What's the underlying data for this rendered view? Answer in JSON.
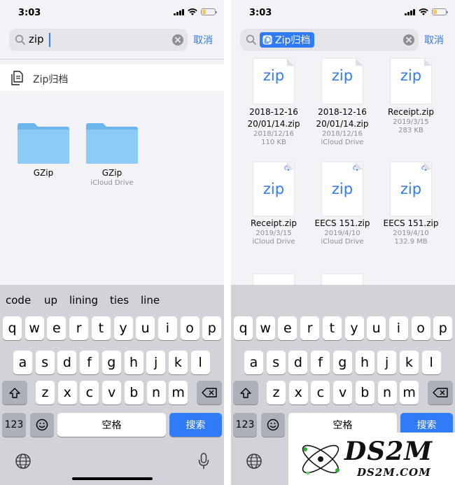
{
  "status_bar": {
    "time": "3:03"
  },
  "left_screen": {
    "search": {
      "query": "zip",
      "cancel_label": "取消"
    },
    "suggestion": {
      "label": "Zip归档"
    },
    "folders": [
      {
        "name": "GZip",
        "location": ""
      },
      {
        "name": "GZip",
        "location": "iCloud Drive"
      }
    ],
    "predictive_words": [
      "code",
      "up",
      "lining",
      "ties",
      "line"
    ]
  },
  "right_screen": {
    "search": {
      "token_label": "Zip归档",
      "cancel_label": "取消"
    },
    "files": [
      {
        "icon_text": "zip",
        "name_line1": "2018-12-16",
        "name_line2": "20/01/14.zip",
        "date": "2018/12/16",
        "detail": "110 KB",
        "cloud": false
      },
      {
        "icon_text": "zip",
        "name_line1": "2018-12-16",
        "name_line2": "20/01/14.zip",
        "date": "2018/12/16",
        "detail": "iCloud Drive",
        "cloud": false
      },
      {
        "icon_text": "zip",
        "name_line1": "Receipt.zip",
        "name_line2": "",
        "date": "2019/3/15",
        "detail": "283 KB",
        "cloud": false
      },
      {
        "icon_text": "zip",
        "name_line1": "Receipt.zip",
        "name_line2": "",
        "date": "2019/3/15",
        "detail": "iCloud Drive",
        "cloud": true
      },
      {
        "icon_text": "zip",
        "name_line1": "EECS 151.zip",
        "name_line2": "",
        "date": "2019/4/10",
        "detail": "iCloud Drive",
        "cloud": true
      },
      {
        "icon_text": "zip",
        "name_line1": "EECS 151.zip",
        "name_line2": "",
        "date": "2019/4/10",
        "detail": "132.9 MB",
        "cloud": true
      }
    ]
  },
  "keyboard": {
    "row1": [
      "q",
      "w",
      "e",
      "r",
      "t",
      "y",
      "u",
      "i",
      "o",
      "p"
    ],
    "row2": [
      "a",
      "s",
      "d",
      "f",
      "g",
      "h",
      "j",
      "k",
      "l"
    ],
    "row3": [
      "z",
      "x",
      "c",
      "v",
      "b",
      "n",
      "m"
    ],
    "numbers_label": "123",
    "space_label": "空格",
    "search_label": "搜索",
    "icons": {
      "shift": "shift-icon",
      "delete": "delete-icon",
      "emoji": "emoji-icon",
      "globe": "globe-icon",
      "mic": "microphone-icon"
    }
  },
  "watermark": {
    "text": "DS2M",
    "subtext": "DS2M.COM"
  },
  "colors": {
    "accent": "#2f7cf6",
    "background": "#f2f2f7",
    "keyboard": "#d1d3d9",
    "folder": "#7cc0f2"
  }
}
